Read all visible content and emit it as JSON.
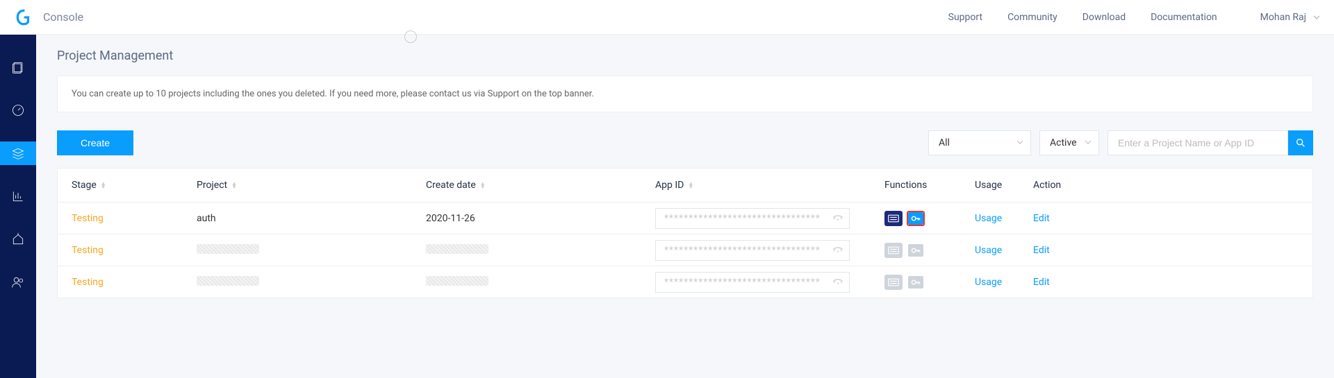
{
  "header": {
    "console_label": "Console",
    "nav": {
      "support": "Support",
      "community": "Community",
      "download": "Download",
      "documentation": "Documentation"
    },
    "user": "Mohan Raj"
  },
  "page": {
    "title": "Project Management",
    "info": "You can create up to 10 projects including the ones you deleted. If you need more, please contact us via Support on the top banner.",
    "create_label": "Create",
    "filter_all": "All",
    "filter_status": "Active",
    "search_placeholder": "Enter a Project Name or App ID"
  },
  "table": {
    "headers": {
      "stage": "Stage",
      "project": "Project",
      "created": "Create date",
      "appid": "App ID",
      "functions": "Functions",
      "usage": "Usage",
      "action": "Action"
    },
    "usage_label": "Usage",
    "edit_label": "Edit",
    "rows": [
      {
        "stage": "Testing",
        "project": "auth",
        "created": "2020-11-26",
        "appid_mask": "********************************",
        "redacted": false,
        "highlighted": true
      },
      {
        "stage": "Testing",
        "project": "",
        "created": "",
        "appid_mask": "********************************",
        "redacted": true,
        "highlighted": false
      },
      {
        "stage": "Testing",
        "project": "",
        "created": "",
        "appid_mask": "********************************",
        "redacted": true,
        "highlighted": false
      }
    ]
  }
}
